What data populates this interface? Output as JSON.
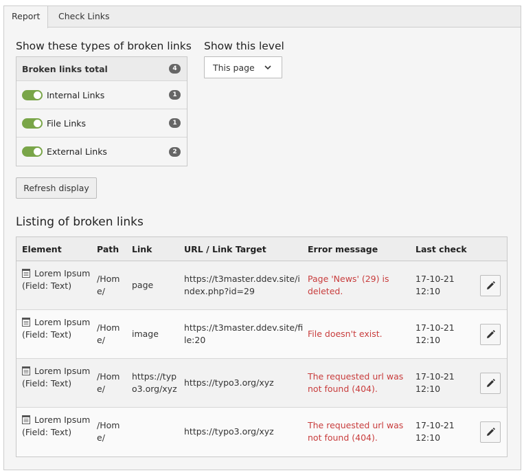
{
  "tabs": [
    "Report",
    "Check Links"
  ],
  "filters": {
    "heading": "Show these types of broken links",
    "total_label": "Broken links total",
    "total_count": "4",
    "types": [
      {
        "label": "Internal Links",
        "count": "1",
        "enabled": true
      },
      {
        "label": "File Links",
        "count": "1",
        "enabled": true
      },
      {
        "label": "External Links",
        "count": "2",
        "enabled": true
      }
    ]
  },
  "level": {
    "heading": "Show this level",
    "selected": "This page"
  },
  "refresh_label": "Refresh display",
  "listing": {
    "heading": "Listing of broken links",
    "columns": [
      "Element",
      "Path",
      "Link",
      "URL / Link Target",
      "Error message",
      "Last check"
    ],
    "rows": [
      {
        "element": "Lorem Ipsum (Field: Text)",
        "path": "/Home/",
        "link": "page",
        "url": "https://t3master.ddev.site/index.php?id=29",
        "error": "Page 'News' (29) is deleted.",
        "last_check": "17-10-21 12:10"
      },
      {
        "element": "Lorem Ipsum (Field: Text)",
        "path": "/Home/",
        "link": "image",
        "url": "https://t3master.ddev.site/file:20",
        "error": "File doesn't exist.",
        "last_check": "17-10-21 12:10"
      },
      {
        "element": "Lorem Ipsum (Field: Text)",
        "path": "/Home/",
        "link": "https://typo3.org/xyz",
        "url": "https://typo3.org/xyz",
        "error": "The requested url was not found (404).",
        "last_check": "17-10-21 12:10"
      },
      {
        "element": "Lorem Ipsum (Field: Text)",
        "path": "/Home/",
        "link": "",
        "url": "https://typo3.org/xyz",
        "error": "The requested url was not found (404).",
        "last_check": "17-10-21 12:10"
      }
    ]
  },
  "colors": {
    "toggle_on": "#79a548",
    "error_text": "#c83c3c",
    "badge": "#666666"
  },
  "icons": {
    "select_chevron": "chevron-down-icon",
    "row_type": "document-icon",
    "row_action": "pencil-icon"
  }
}
